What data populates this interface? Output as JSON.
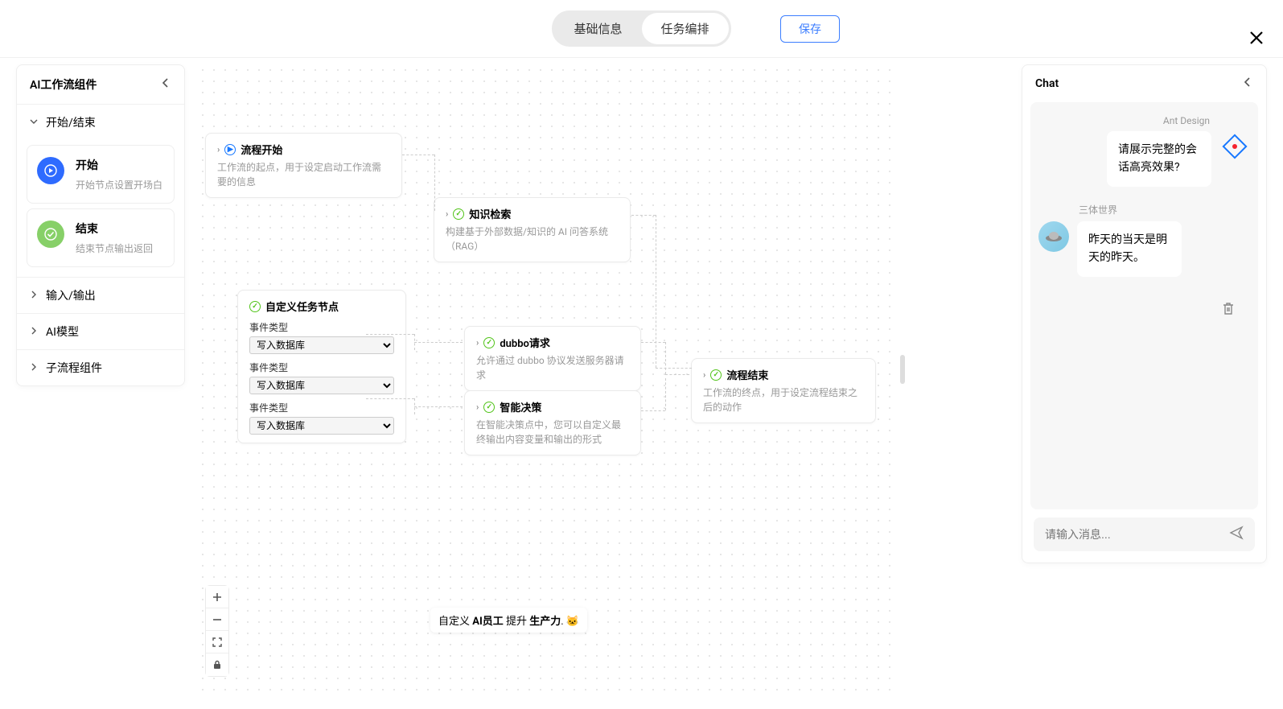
{
  "tabs": {
    "basic": "基础信息",
    "task": "任务编排"
  },
  "save_label": "保存",
  "sidebar": {
    "title": "AI工作流组件",
    "sections": {
      "start_end": {
        "label": "开始/结束",
        "start": {
          "title": "开始",
          "desc": "开始节点设置开场白"
        },
        "end": {
          "title": "结束",
          "desc": "结束节点输出返回"
        }
      },
      "io": "输入/输出",
      "ai": "AI模型",
      "subflow": "子流程组件"
    }
  },
  "nodes": {
    "start": {
      "title": "流程开始",
      "desc": "工作流的起点，用于设定启动工作流需要的信息"
    },
    "kb": {
      "title": "知识检索",
      "desc": "构建基于外部数据/知识的 AI 问答系统（RAG）"
    },
    "custom": {
      "title": "自定义任务节点",
      "field_label": "事件类型",
      "options": [
        "写入数据库"
      ]
    },
    "dubbo": {
      "title": "dubbo请求",
      "desc": "允许通过 dubbo 协议发送服务器请求"
    },
    "decision": {
      "title": "智能决策",
      "desc": "在智能决策点中，您可以自定义最终输出内容变量和输出的形式"
    },
    "end": {
      "title": "流程结束",
      "desc": "工作流的终点，用于设定流程结束之后的动作"
    }
  },
  "bottom_label": {
    "p1": "自定义 ",
    "b1": "AI员工",
    "p2": " 提升 ",
    "b2": "生产力",
    "p3": ". 🐱"
  },
  "chat": {
    "title": "Chat",
    "messages": [
      {
        "sender": "Ant Design",
        "side": "right",
        "text": "请展示完整的会话高亮效果?"
      },
      {
        "sender": "三体世界",
        "side": "left",
        "text": "昨天的当天是明天的昨天。"
      }
    ],
    "placeholder": "请输入消息..."
  }
}
